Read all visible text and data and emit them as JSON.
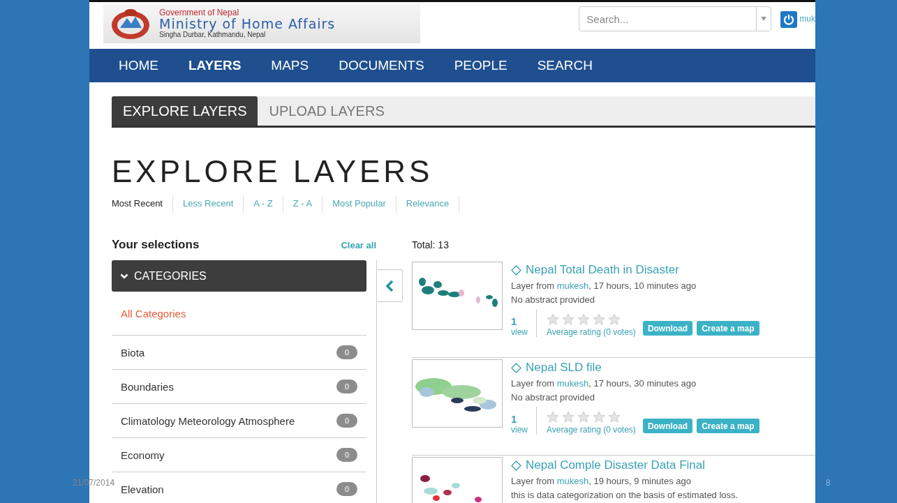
{
  "header": {
    "logo": {
      "line1": "Government of Nepal",
      "line2": "Ministry of Home Affairs",
      "line3": "Singha Durbar, Kathmandu, Nepal"
    },
    "search": {
      "placeholder": "Search..."
    },
    "user": "muk"
  },
  "nav": [
    {
      "label": "HOME",
      "selected": false
    },
    {
      "label": "LAYERS",
      "selected": true
    },
    {
      "label": "MAPS",
      "selected": false
    },
    {
      "label": "DOCUMENTS",
      "selected": false
    },
    {
      "label": "PEOPLE",
      "selected": false
    },
    {
      "label": "SEARCH",
      "selected": false
    }
  ],
  "tabs": [
    {
      "label": "EXPLORE LAYERS",
      "selected": true
    },
    {
      "label": "UPLOAD LAYERS",
      "selected": false
    }
  ],
  "heading": "EXPLORE LAYERS",
  "sort_options": [
    {
      "label": "Most Recent",
      "selected": true
    },
    {
      "label": "Less Recent",
      "selected": false
    },
    {
      "label": "A - Z",
      "selected": false
    },
    {
      "label": "Z - A",
      "selected": false
    },
    {
      "label": "Most Popular",
      "selected": false
    },
    {
      "label": "Relevance",
      "selected": false
    }
  ],
  "sidebar": {
    "title": "Your selections",
    "clear": "Clear all",
    "section": {
      "label": "CATEGORIES",
      "expanded": true
    },
    "categories": [
      {
        "name": "All Categories",
        "selected": true
      },
      {
        "name": "Biota",
        "count": "0",
        "selected": false
      },
      {
        "name": "Boundaries",
        "count": "0",
        "selected": false
      },
      {
        "name": "Climatology Meteorology Atmosphere",
        "count": "0",
        "selected": false
      },
      {
        "name": "Economy",
        "count": "0",
        "selected": false
      },
      {
        "name": "Elevation",
        "count": "0",
        "selected": false
      }
    ]
  },
  "results": {
    "total": "Total: 13",
    "items": [
      {
        "title": "Nepal Total Death in Disaster",
        "owner_prefix": "Layer from",
        "owner": "mukesh",
        "time": ", 17 hours, 10 minutes ago",
        "abstract": "No abstract provided",
        "views": "1",
        "views_label": "view",
        "stars": 0,
        "rating": "Average rating (0 votes)",
        "buttons": [
          "Download",
          "Create a map"
        ]
      },
      {
        "title": "Nepal SLD file",
        "owner_prefix": "Layer from",
        "owner": "mukesh",
        "time": ", 17 hours, 30 minutes ago",
        "abstract": "No abstract provided",
        "views": "1",
        "views_label": "view",
        "stars": 0,
        "rating": "Average rating (0 votes)",
        "buttons": [
          "Download",
          "Create a map"
        ]
      },
      {
        "title": "Nepal Comple Disaster Data Final",
        "owner_prefix": "Layer from",
        "owner": "mukesh",
        "time": ", 19 hours, 9 minutes ago",
        "abstract": "this is data categorization on the basis of estimated loss."
      }
    ]
  },
  "slide": {
    "date": "21/07/2014",
    "page": "8"
  }
}
